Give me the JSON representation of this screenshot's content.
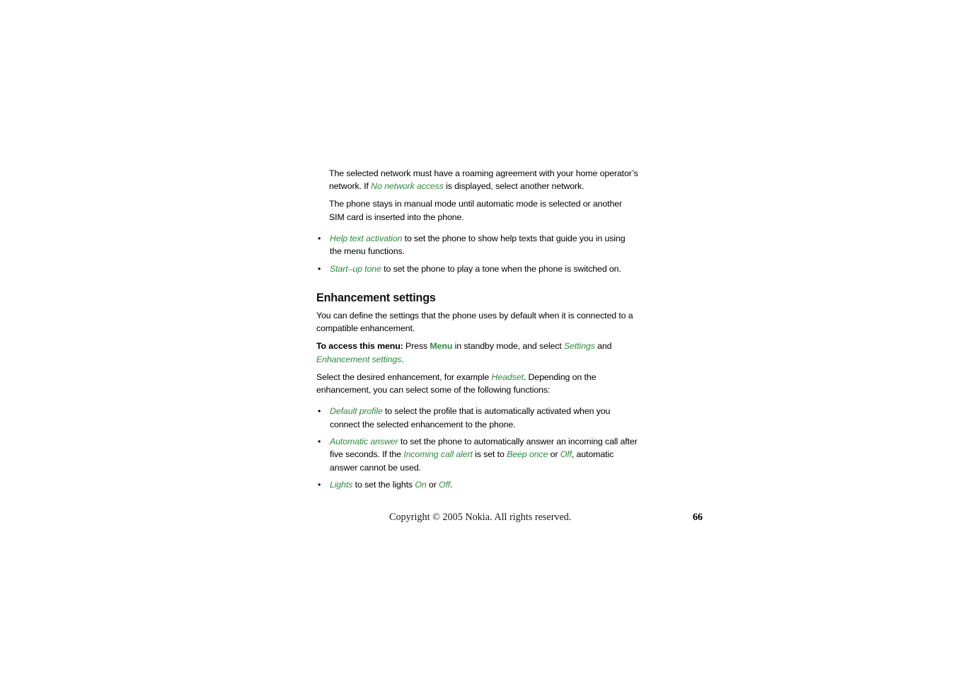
{
  "document": {
    "page_number": "66",
    "accent_green": "#2e8b3c",
    "text_color": "#000000",
    "background": "#ffffff"
  },
  "body": {
    "intro_paragraphs": [
      {
        "id": "roaming-note",
        "runs": [
          {
            "type": "text",
            "text": "The selected network must have a roaming agreement with your home operator’s network. If "
          },
          {
            "type": "ui-term",
            "text": "No network access"
          },
          {
            "type": "text",
            "text": " is displayed, select another network."
          }
        ]
      },
      {
        "id": "manual-mode-note",
        "runs": [
          {
            "type": "text",
            "text": "The phone stays in manual mode until automatic mode is selected or another SIM card is inserted into the phone."
          }
        ]
      }
    ],
    "settings_bullets": [
      {
        "id": "help-text-activation",
        "marker": "•",
        "runs": [
          {
            "type": "ui-term",
            "text": "Help text activation"
          },
          {
            "type": "text",
            "text": " to set the phone to show help texts that guide you in using the menu functions."
          }
        ]
      },
      {
        "id": "start-up-tone",
        "marker": "•",
        "runs": [
          {
            "type": "ui-term",
            "text": "Start–up tone"
          },
          {
            "type": "text",
            "text": " to set the phone to play a tone when the phone is switched on."
          }
        ]
      }
    ],
    "section": {
      "heading": "Enhancement settings",
      "intro": {
        "id": "enhancement-intro",
        "runs": [
          {
            "type": "text",
            "text": "You can define the settings that the phone uses by default when it is connected to a compatible enhancement."
          }
        ]
      },
      "access_path": {
        "id": "enhancement-access",
        "runs": [
          {
            "type": "strong",
            "text": "To access this menu:"
          },
          {
            "type": "text",
            "text": " Press "
          },
          {
            "type": "ui-key",
            "text": "Menu"
          },
          {
            "type": "text",
            "text": " in standby mode, and select "
          },
          {
            "type": "ui-term",
            "text": "Settings"
          },
          {
            "type": "text",
            "text": " and "
          },
          {
            "type": "ui-term",
            "text": "Enhancement settings"
          },
          {
            "type": "text",
            "text": "."
          }
        ]
      },
      "select_note": {
        "id": "enhancement-select",
        "runs": [
          {
            "type": "text",
            "text": "Select the desired enhancement, for example "
          },
          {
            "type": "ui-term",
            "text": "Headset"
          },
          {
            "type": "text",
            "text": ". Depending on the enhancement, you can select some of the following functions:"
          }
        ]
      },
      "function_bullets": [
        {
          "id": "default-profile",
          "marker": "•",
          "runs": [
            {
              "type": "ui-term",
              "text": "Default profile"
            },
            {
              "type": "text",
              "text": " to select the profile that is automatically activated when you connect the selected enhancement to the phone."
            }
          ]
        },
        {
          "id": "automatic-answer",
          "marker": "•",
          "runs": [
            {
              "type": "ui-term",
              "text": "Automatic answer"
            },
            {
              "type": "text",
              "text": " to set the phone to automatically answer an incoming call after five seconds. If the "
            },
            {
              "type": "ui-term",
              "text": "Incoming call alert"
            },
            {
              "type": "text",
              "text": " is set to "
            },
            {
              "type": "ui-term",
              "text": "Beep once"
            },
            {
              "type": "text",
              "text": " or "
            },
            {
              "type": "ui-term",
              "text": "Off"
            },
            {
              "type": "text",
              "text": ", automatic answer cannot be used."
            }
          ]
        },
        {
          "id": "lights",
          "marker": "•",
          "runs": [
            {
              "type": "ui-term",
              "text": "Lights"
            },
            {
              "type": "text",
              "text": " to set the lights  "
            },
            {
              "type": "ui-term",
              "text": "On"
            },
            {
              "type": "text",
              "text": " or "
            },
            {
              "type": "ui-term",
              "text": "Off"
            },
            {
              "type": "text",
              "text": "."
            }
          ]
        }
      ]
    }
  },
  "footer": {
    "copyright": "Copyright © 2005 Nokia. All rights reserved.",
    "page_number": "66"
  }
}
